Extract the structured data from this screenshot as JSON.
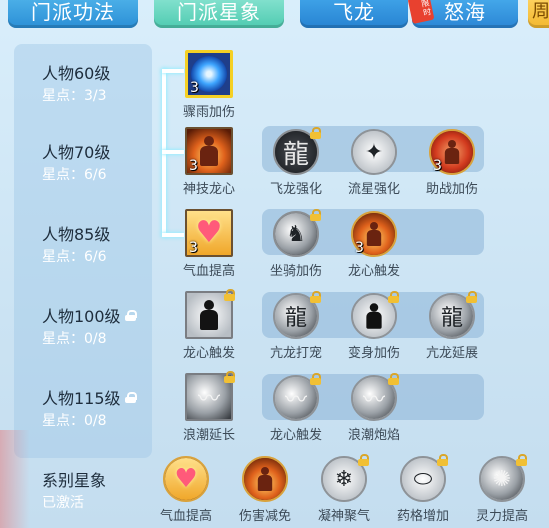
{
  "tabs": [
    {
      "label": "门派功法"
    },
    {
      "label": "门派星象"
    },
    {
      "label": "飞龙"
    },
    {
      "label": "怒海",
      "badge": "限时"
    },
    {
      "label": "周"
    }
  ],
  "levels": [
    {
      "name": "人物60级",
      "points": "星点：3/3",
      "locked": false
    },
    {
      "name": "人物70级",
      "points": "星点：6/6",
      "locked": false
    },
    {
      "name": "人物85级",
      "points": "星点：6/6",
      "locked": false
    },
    {
      "name": "人物100级",
      "points": "星点：0/8",
      "locked": true
    },
    {
      "name": "人物115级",
      "points": "星点：0/8",
      "locked": true
    }
  ],
  "system_star": {
    "name": "系别星象",
    "status": "已激活"
  },
  "rows": [
    {
      "main": {
        "label": "骤雨加伤",
        "count": "3",
        "icon": "whirlpool-icon"
      },
      "subs": []
    },
    {
      "main": {
        "label": "神技龙心",
        "count": "3",
        "icon": "fire-figure-icon"
      },
      "subs": [
        {
          "label": "飞龙强化",
          "count": "",
          "locked": true,
          "icon": "dragon-icon"
        },
        {
          "label": "流星强化",
          "count": "",
          "locked": false,
          "icon": "meteor-icon"
        },
        {
          "label": "助战加伤",
          "count": "3",
          "locked": false,
          "icon": "aura-figure-icon"
        }
      ]
    },
    {
      "main": {
        "label": "气血提高",
        "count": "3",
        "icon": "heart-icon"
      },
      "subs": [
        {
          "label": "坐骑加伤",
          "count": "",
          "locked": true,
          "icon": "mount-icon"
        },
        {
          "label": "龙心触发",
          "count": "3",
          "locked": false,
          "icon": "fire-figure-icon"
        }
      ]
    },
    {
      "main": {
        "label": "龙心触发",
        "count": "",
        "locked": true,
        "icon": "figure-icon"
      },
      "subs": [
        {
          "label": "亢龙打宠",
          "count": "",
          "locked": true,
          "icon": "dragon-strike-icon"
        },
        {
          "label": "变身加伤",
          "count": "",
          "locked": true,
          "icon": "transform-icon"
        },
        {
          "label": "亢龙延展",
          "count": "",
          "locked": true,
          "icon": "dragon-extend-icon"
        }
      ]
    },
    {
      "main": {
        "label": "浪潮延长",
        "count": "",
        "locked": true,
        "icon": "wave-icon"
      },
      "subs": [
        {
          "label": "龙心触发",
          "count": "",
          "locked": true,
          "icon": "wave-icon"
        },
        {
          "label": "浪潮炮焰",
          "count": "",
          "locked": true,
          "icon": "wave-icon"
        }
      ]
    }
  ],
  "bottom": [
    {
      "label": "气血提高",
      "locked": false,
      "icon": "heart-icon"
    },
    {
      "label": "伤害减免",
      "locked": false,
      "icon": "fire-figure-icon"
    },
    {
      "label": "凝神聚气",
      "locked": true,
      "icon": "focus-icon"
    },
    {
      "label": "药格增加",
      "locked": true,
      "icon": "potion-icon"
    },
    {
      "label": "灵力提高",
      "locked": true,
      "icon": "spirit-icon"
    }
  ]
}
